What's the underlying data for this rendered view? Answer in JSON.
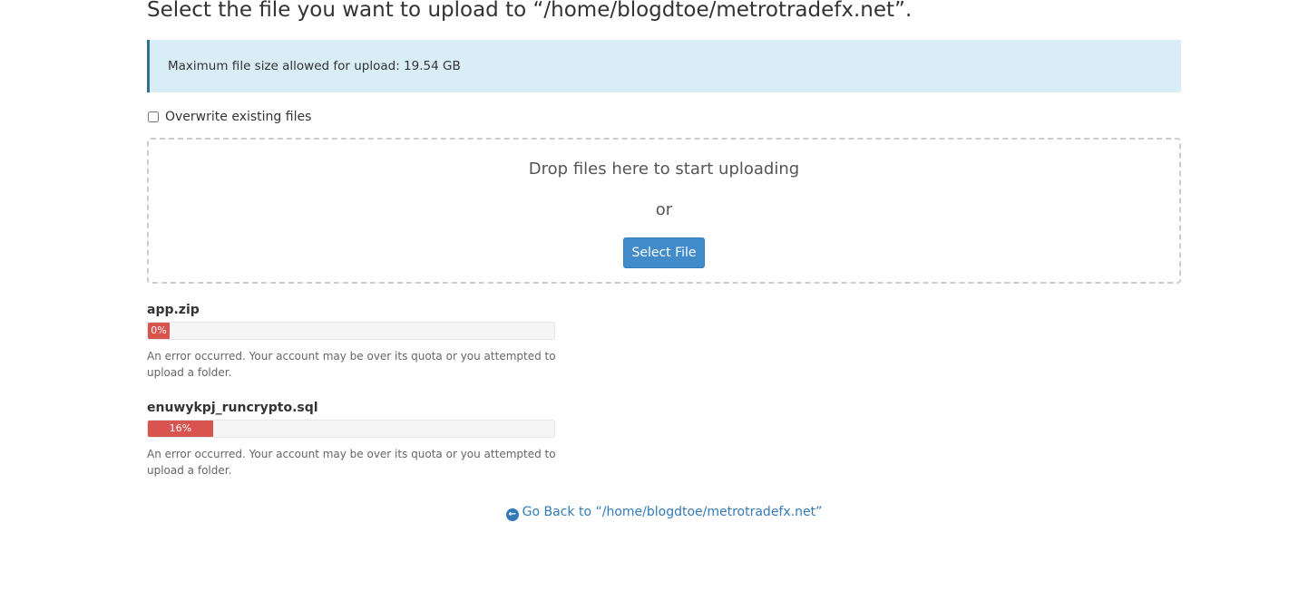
{
  "page": {
    "title": "Select the file you want to upload to “/home/blogdtoe/metrotradefx.net”."
  },
  "alert": {
    "text": "Maximum file size allowed for upload: 19.54 GB"
  },
  "overwrite": {
    "label": "Overwrite existing files",
    "checked": false
  },
  "dropzone": {
    "drop_text": "Drop files here to start uploading",
    "or_text": "or",
    "select_button_label": "Select File"
  },
  "uploads": [
    {
      "file_name": "app.zip",
      "progress_label": "0%",
      "progress_fraction": 0.0,
      "status_color": "#d9534f",
      "error": "An error occurred. Your account may be over its quota or you attempted to upload a folder."
    },
    {
      "file_name": "enuwykpj_runcrypto.sql",
      "progress_label": "16%",
      "progress_fraction": 0.16,
      "status_color": "#d9534f",
      "error": "An error occurred. Your account may be over its quota or you attempted to upload a folder."
    }
  ],
  "go_back": {
    "icon": "arrow-circle-left-icon",
    "label": "Go Back to “/home/blogdtoe/metrotradefx.net”"
  },
  "colors": {
    "accent": "#428bca",
    "alert_bg": "#d9edf7",
    "error": "#d9534f",
    "link": "#337ab7"
  }
}
